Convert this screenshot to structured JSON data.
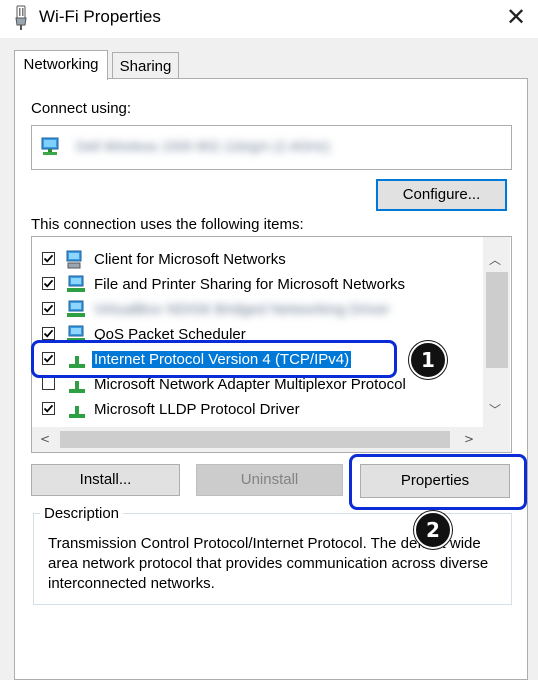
{
  "window": {
    "title": "Wi-Fi Properties",
    "close_glyph": "✕"
  },
  "tabs": [
    {
      "label": "Networking",
      "active": true
    },
    {
      "label": "Sharing",
      "active": false
    }
  ],
  "connect_using": {
    "label": "Connect using:",
    "adapter_name": "Dell Wireless 1500 802.11b/g/n (2.4GHz)",
    "icon": "network-adapter-icon"
  },
  "buttons": {
    "configure": "Configure...",
    "install": "Install...",
    "uninstall": "Uninstall",
    "properties": "Properties"
  },
  "items_label": "This connection uses the following items:",
  "items": [
    {
      "label": "Client for Microsoft Networks",
      "checked": true,
      "icon": "network-client-icon"
    },
    {
      "label": "File and Printer Sharing for Microsoft Networks",
      "checked": true,
      "icon": "network-service-icon"
    },
    {
      "label": "VirtualBox NDIS6 Bridged Networking Driver",
      "checked": true,
      "icon": "network-service-icon",
      "blurred": true
    },
    {
      "label": "QoS Packet Scheduler",
      "checked": true,
      "icon": "network-service-icon"
    },
    {
      "label": "Internet Protocol Version 4 (TCP/IPv4)",
      "checked": true,
      "icon": "protocol-icon",
      "selected": true
    },
    {
      "label": "Microsoft Network Adapter Multiplexor Protocol",
      "checked": false,
      "icon": "protocol-icon"
    },
    {
      "label": "Microsoft LLDP Protocol Driver",
      "checked": true,
      "icon": "protocol-icon"
    }
  ],
  "description": {
    "label": "Description",
    "text": "Transmission Control Protocol/Internet Protocol. The default wide area network protocol that provides communication across diverse interconnected networks."
  },
  "annotations": {
    "step1": "1",
    "step2": "2",
    "color": "#0a2bd6"
  },
  "colors": {
    "selection": "#0078d7",
    "window_bg": "#f0f0f0"
  }
}
